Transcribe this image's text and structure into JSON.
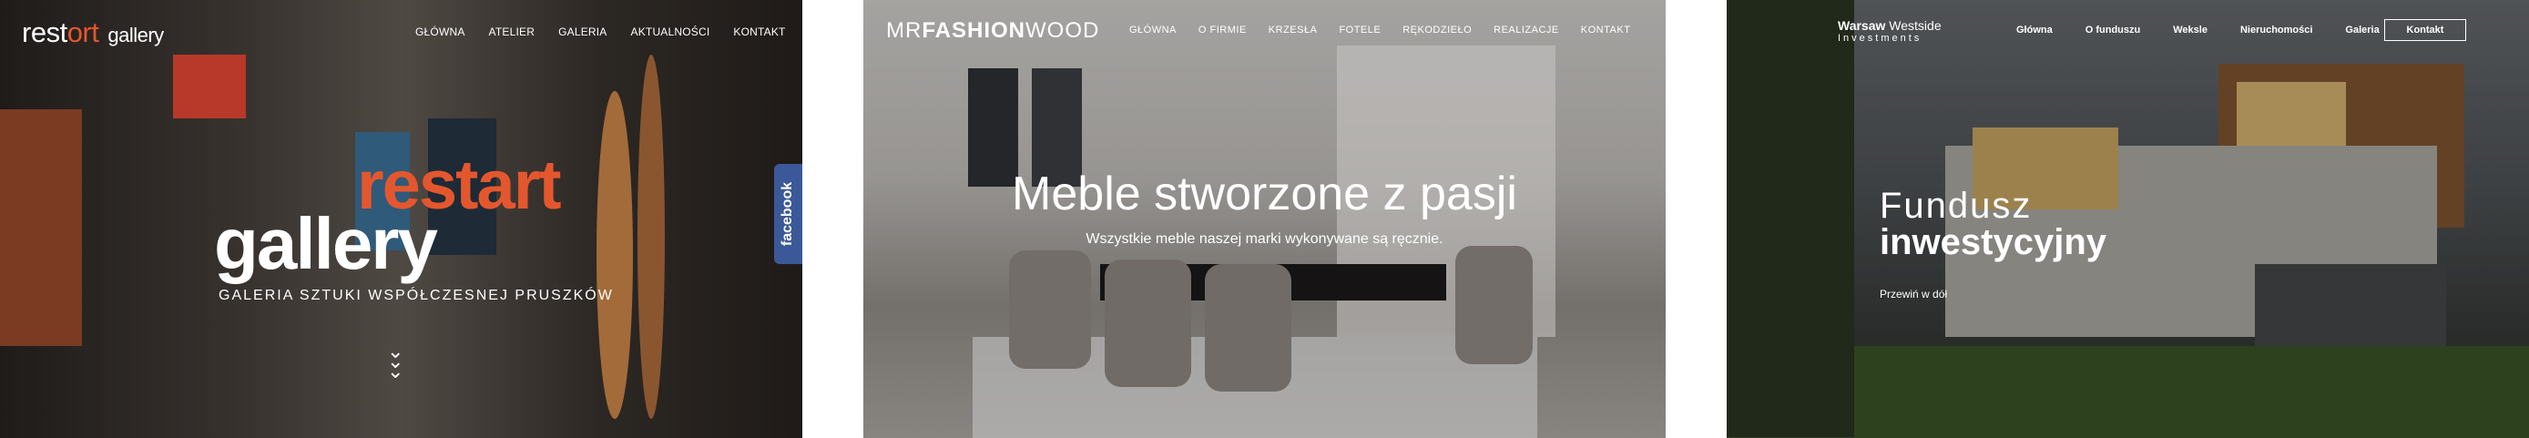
{
  "gallery": {
    "logo": {
      "part1": "rest",
      "accent": "ort",
      "part2": "gallery"
    },
    "nav": [
      "GŁÓWNA",
      "ATELIER",
      "GALERIA",
      "AKTUALNOŚCI",
      "KONTAKT"
    ],
    "headline_accent": "restart",
    "headline": "gallery",
    "subtitle": "GALERIA SZTUKI WSPÓŁCZESNEJ PRUSZKÓW",
    "scroll_icon": "chevrons-down-icon",
    "facebook_tab": "facebook",
    "accent_color": "#e4572e",
    "facebook_color": "#3b5998"
  },
  "fashion": {
    "logo": {
      "part1": "MR",
      "bold": "FASHION",
      "part2": "WOOD"
    },
    "nav": [
      "GŁÓWNA",
      "O FIRMIE",
      "KRZESŁA",
      "FOTELE",
      "RĘKODZIEŁO",
      "REALIZACJE",
      "KONTAKT"
    ],
    "headline": "Meble stworzone z pasji",
    "subtitle": "Wszystkie meble naszej marki wykonywane są ręcznie."
  },
  "westside": {
    "logo": {
      "bold": "Warsaw",
      "thin": "Westside",
      "line2": "Investments"
    },
    "nav": [
      "Główna",
      "O funduszu",
      "Weksle",
      "Nieruchomości",
      "Galeria"
    ],
    "contact_button": "Kontakt",
    "headline_light": "Fundusz",
    "headline_bold": "inwestycyjny",
    "scroll_text": "Przewiń w dół"
  }
}
